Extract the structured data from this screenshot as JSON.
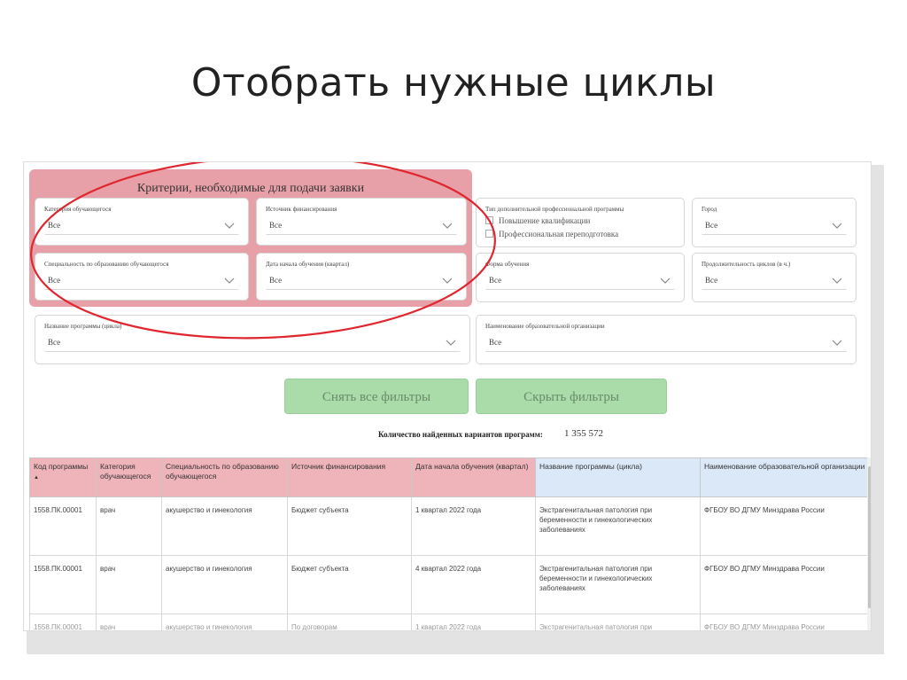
{
  "slide": {
    "title": "Отобрать нужные циклы"
  },
  "criteria": {
    "title": "Критерии, необходимые для подачи заявки",
    "category": {
      "label": "Категория обучающегося",
      "value": "Все"
    },
    "funding": {
      "label": "Источник финансирования",
      "value": "Все"
    },
    "specialty": {
      "label": "Специальность по образованию обучающегося",
      "value": "Все"
    },
    "start_date": {
      "label": "Дата начала обучения (квартал)",
      "value": "Все"
    }
  },
  "filters": {
    "program_type": {
      "label": "Тип дополнительной профессиональной программы",
      "options": [
        "Повышение квалификации",
        "Профессиональная переподготовка"
      ]
    },
    "city": {
      "label": "Город",
      "value": "Все"
    },
    "study_form": {
      "label": "Форма обучения",
      "value": "Все"
    },
    "duration": {
      "label": "Продолжительность циклов (в ч.)",
      "value": "Все"
    },
    "program_name": {
      "label": "Название программы (цикла)",
      "value": "Все"
    },
    "organization": {
      "label": "Наименование образовательной организации",
      "value": "Все"
    }
  },
  "buttons": {
    "clear": "Снять все фильтры",
    "hide": "Скрыть фильтры"
  },
  "results": {
    "count_label": "Количество найденных вариантов программ:",
    "count_value": "1 355 572"
  },
  "table": {
    "headers": [
      "Код программы",
      "Категория обучающегося",
      "Специальность по образованию обучающегося",
      "Источник финансирования",
      "Дата начала обучения (квартал)",
      "Название программы (цикла)",
      "Наименование образовательной организации"
    ],
    "sort_indicator": "▲",
    "rows": [
      [
        "1558.ПК.00001",
        "врач",
        "акушерство и гинекология",
        "Бюджет субъекта",
        "1 квартал 2022 года",
        "Экстрагенитальная патология при беременности и гинекологических заболеваниях",
        "ФГБОУ ВО ДГМУ Минздрава России"
      ],
      [
        "1558.ПК.00001",
        "врач",
        "акушерство и гинекология",
        "Бюджет субъекта",
        "4 квартал 2022 года",
        "Экстрагенитальная патология при беременности и гинекологических заболеваниях",
        "ФГБОУ ВО ДГМУ Минздрава России"
      ],
      [
        "1558.ПК.00001",
        "врач",
        "акушерство и гинекология",
        "По договорам",
        "1 квартал 2022 года",
        "Экстрагенитальная патология при",
        "ФГБОУ ВО ДГМУ Минздрава России"
      ]
    ]
  },
  "colors": {
    "criteria_panel": "#e8a0a8",
    "annotation": "#e0262e",
    "button": "#a9dca9"
  },
  "icons": {
    "dropdown": "chevron-down-icon",
    "checkbox": "checkbox-icon"
  }
}
